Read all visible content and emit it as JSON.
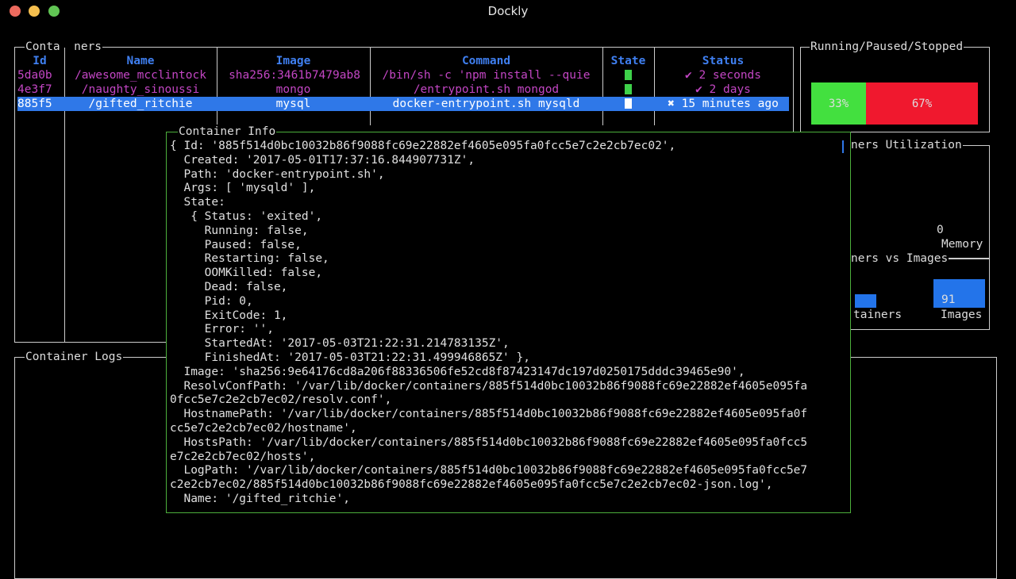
{
  "window": {
    "title": "Dockly"
  },
  "containers_panel": {
    "title": "Conta  ners",
    "headers": [
      "Id",
      "Name",
      "Image",
      "Command",
      "State",
      "Status"
    ],
    "rows": [
      {
        "id": "5da0b",
        "name": "/awesome_mcclintock",
        "image": "sha256:3461b7479ab8",
        "command": "/bin/sh -c 'npm install --quie",
        "state_color": "#3ed14a",
        "status": "✔ 2 seconds"
      },
      {
        "id": "4e3f7",
        "name": "/naughty_sinoussi",
        "image": "mongo",
        "command": "/entrypoint.sh mongod",
        "state_color": "#3ed14a",
        "status": "✔ 2 days"
      },
      {
        "id": "885f5",
        "name": "/gifted_ritchie",
        "image": "mysql",
        "command": "docker-entrypoint.sh mysqld",
        "state_color": "#ffffff",
        "status": "✖ 15 minutes ago"
      }
    ]
  },
  "rps_panel": {
    "title": "Running/Paused/Stopped",
    "running_label": "33%",
    "stopped_label": "67%",
    "running_fraction": 0.33,
    "stopped_fraction": 0.67,
    "colors": {
      "running": "#43e03f",
      "stopped": "#f0182e"
    }
  },
  "utilization_panel": {
    "title": "ners Utilization",
    "memory_value": "0",
    "memory_label": "Memory"
  },
  "cvi_panel": {
    "title": "ners vs Images",
    "containers_label": "tainers",
    "images_value": "91",
    "images_label": "Images",
    "bar_color": "#2374ea"
  },
  "logs_panel": {
    "title": "Container Logs"
  },
  "info_panel": {
    "title": "Container Info",
    "lines": [
      "{ Id: '885f514d0bc10032b86f9088fc69e22882ef4605e095fa0fcc5e7c2e2cb7ec02',",
      "  Created: '2017-05-01T17:37:16.844907731Z',",
      "  Path: 'docker-entrypoint.sh',",
      "  Args: [ 'mysqld' ],",
      "  State:",
      "   { Status: 'exited',",
      "     Running: false,",
      "     Paused: false,",
      "     Restarting: false,",
      "     OOMKilled: false,",
      "     Dead: false,",
      "     Pid: 0,",
      "     ExitCode: 1,",
      "     Error: '',",
      "     StartedAt: '2017-05-03T21:22:31.214783135Z',",
      "     FinishedAt: '2017-05-03T21:22:31.499946865Z' },",
      "  Image: 'sha256:9e64176cd8a206f88336506fe52cd8f87423147dc197d0250175dddc39465e90',",
      "  ResolvConfPath: '/var/lib/docker/containers/885f514d0bc10032b86f9088fc69e22882ef4605e095fa",
      "0fcc5e7c2e2cb7ec02/resolv.conf',",
      "  HostnamePath: '/var/lib/docker/containers/885f514d0bc10032b86f9088fc69e22882ef4605e095fa0f",
      "cc5e7c2e2cb7ec02/hostname',",
      "  HostsPath: '/var/lib/docker/containers/885f514d0bc10032b86f9088fc69e22882ef4605e095fa0fcc5",
      "e7c2e2cb7ec02/hosts',",
      "  LogPath: '/var/lib/docker/containers/885f514d0bc10032b86f9088fc69e22882ef4605e095fa0fcc5e7",
      "c2e2cb7ec02/885f514d0bc10032b86f9088fc69e22882ef4605e095fa0fcc5e7c2e2cb7ec02-json.log',",
      "  Name: '/gifted_ritchie',"
    ]
  }
}
